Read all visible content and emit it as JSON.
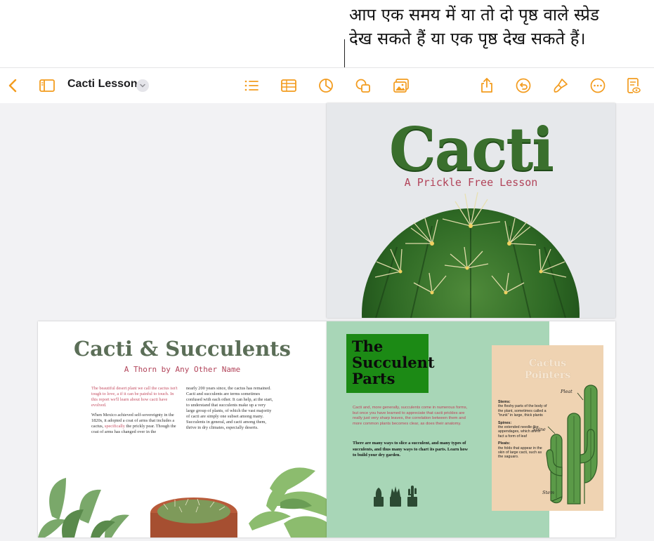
{
  "callout": {
    "line1": "आप एक समय में या तो दो पृष्ठ वाले स्प्रेड",
    "line2": "देख सकते हैं या एक पृष्ठ देख सकते हैं।"
  },
  "toolbar": {
    "document_title": "Cacti Lesson",
    "icons": [
      "back-chevron-icon",
      "sidebar-icon",
      "title-chevron-down-icon",
      "list-icon",
      "table-icon",
      "chart-icon",
      "shapes-icon",
      "media-icon",
      "share-icon",
      "undo-icon",
      "paintbrush-icon",
      "more-icon",
      "reading-view-icon"
    ]
  },
  "cover": {
    "title": "Cacti",
    "subtitle": "A Prickle Free Lesson"
  },
  "left_page": {
    "title": "Cacti & Succulents",
    "subtitle": "A Thorn by Any Other Name",
    "col1_intro": "The beautiful desert plant we call the cactus isn't tough to love, a if it can be painful to touch. In this report we'll learn about how cacti have evolved.",
    "col1_body_a": "When Mexico achieved self-sovereignty in the 1820s, it adopted a coat of arms that includes a cactus,",
    "col1_body_link": "specifically",
    "col1_body_b": "the prickly pear. Though the coat of arms has changed over in the",
    "col2_body": "nearly 200 years since, the cactus has remained. Cacti and succulents are terms sometimes confused with each other. It can help, at the start, to understand that succulents make up a very large group of plants, of which the vast majority of cacti are simply one subset among many. Succulents in general, and cacti among them, thrive in dry climates, especially deserts."
  },
  "right_page": {
    "title_line1": "The",
    "title_line2": "Succulent",
    "title_line3": "Parts",
    "intro_red": "Cacti and, more generally, succulents come in numerous forms, but once you have learned to appreciate that cacti prickles are really just very sharp leaves, the correlation between them and more common plants becomes clear, as does their anatomy.",
    "intro_black": "There are many ways to slice a succulent, and many types of succulents, and thus many ways to chart its parts. Learn how to build your dry garden.",
    "card": {
      "title_line1": "Cactus",
      "title_line2": "Pointers",
      "stems_label": "Stems:",
      "stems_text": "the fleshy parts of the body of the plant, sometimes called a \"trunk\" in large, thick plants",
      "spines_label": "Spines:",
      "spines_text": "the extended needle-like appendages, which are in fact a form of leaf",
      "pleats_label": "Pleats:",
      "pleats_text": "the folds that appear in the skin of large cacti, such as the saguaro.",
      "anno_pleat": "Pleat",
      "anno_spine": "Spine",
      "anno_stem": "Stem"
    }
  },
  "colors": {
    "accent_orange": "#f39c1f",
    "cover_green": "#3a6f2d",
    "heading_pink": "#b2445a",
    "panel_green": "#a8d6b7",
    "card_tan": "#efd3b2"
  }
}
